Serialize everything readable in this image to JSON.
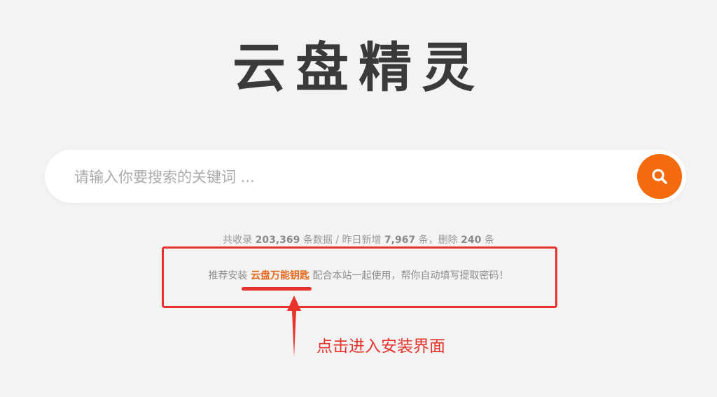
{
  "logo": {
    "text": "云盘精灵"
  },
  "search": {
    "placeholder": "请输入你要搜索的关键词 ...",
    "button_icon": "search-icon"
  },
  "stats": {
    "prefix": "共收录",
    "total": "203,369",
    "mid1": "条数据 / 昨日新增",
    "new_today": "7,967",
    "mid2": "条，删除",
    "deleted": "240",
    "suffix": "条"
  },
  "recommend": {
    "prefix": "推荐安装",
    "app_name": "云盘万能钥匙",
    "suffix": "配合本站一起使用，帮你自动填写提取密码！"
  },
  "annotation": {
    "callout": "点击进入安装界面"
  },
  "colors": {
    "accent": "#f36a0f",
    "annotation_red": "#e8322c",
    "background": "#f3f3f3"
  }
}
